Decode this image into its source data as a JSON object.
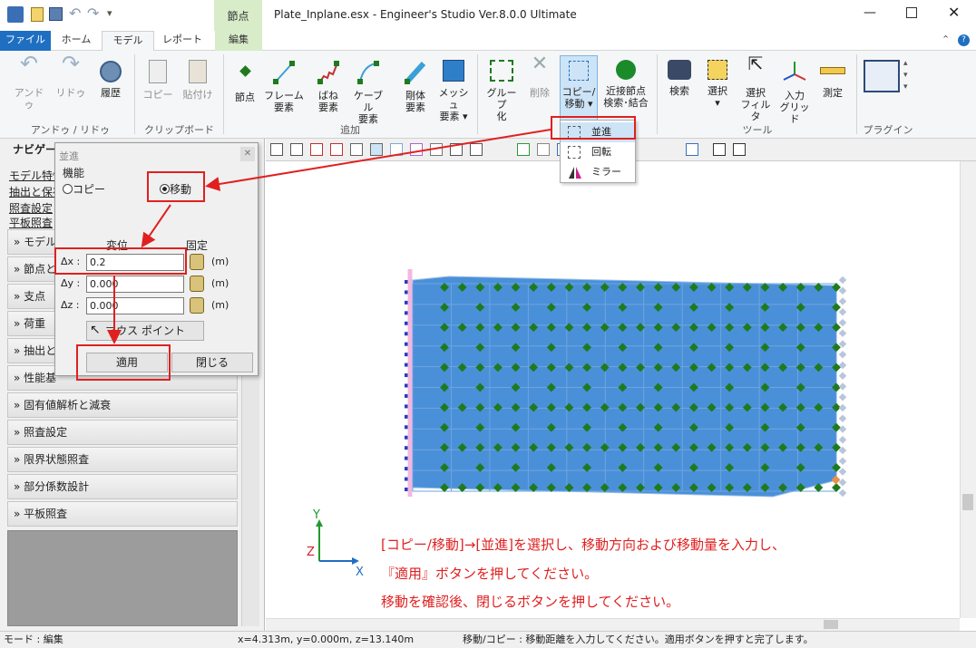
{
  "titlebar": {
    "title": "Plate_Inplane.esx - Engineer's Studio Ver.8.0.0 Ultimate",
    "context_tab": "節点"
  },
  "tabs": [
    "ファイル",
    "ホーム",
    "モデル",
    "レポート",
    "編集"
  ],
  "ribbon": {
    "undo": {
      "items": [
        "アンドゥ",
        "リドゥ",
        "履歴"
      ],
      "group": "アンドゥ / リドゥ"
    },
    "clipboard": {
      "items": [
        "コピー",
        "貼付け"
      ],
      "group": "クリップボード"
    },
    "add": {
      "node": "節点",
      "frame": [
        "フレーム",
        "要素"
      ],
      "spring": [
        "ばね",
        "要素"
      ],
      "cable": [
        "ケーブル",
        "要素"
      ],
      "rigid": [
        "剛体",
        "要素"
      ],
      "mesh": [
        "メッシュ",
        "要素 ▾"
      ],
      "group": "追加"
    },
    "edit": {
      "grouping": [
        "グループ",
        "化"
      ],
      "delete": "削除",
      "copymove": [
        "コピー/",
        "移動 ▾"
      ],
      "nearnode": [
        "近接節点",
        "検索･結合"
      ]
    },
    "tools": {
      "search": "検索",
      "select": [
        "選択",
        "▾"
      ],
      "filter": [
        "選択",
        "フィルタ"
      ],
      "grid": [
        "入力",
        "グリッド"
      ],
      "measure": "測定",
      "group": "ツール"
    },
    "plugin": {
      "group": "プラグイン"
    }
  },
  "dropdown": {
    "items": [
      "並進",
      "回転",
      "ミラー"
    ]
  },
  "navigator": {
    "title": "ナビゲー",
    "links": [
      "モデル特性",
      "抽出と保存",
      "照査設定",
      "平板照査"
    ],
    "rows": [
      "» モデル",
      "» 節点と",
      "» 支点",
      "» 荷重",
      "» 抽出と",
      "» 性能基",
      "» 固有値解析と減衰",
      "» 照査設定",
      "» 限界状態照査",
      "» 部分係数設計",
      "» 平板照査"
    ]
  },
  "dialog": {
    "title": "並進",
    "function_label": "機能",
    "copy": "コピー",
    "move": "移動",
    "disp_header": "変位",
    "fixed_header": "固定",
    "dx_label": "Δx :",
    "dy_label": "Δy :",
    "dz_label": "Δz :",
    "dx": "0.2",
    "dy": "0.000",
    "dz": "0.000",
    "unit": "(m)",
    "mouse_point": "マウス ポイント",
    "apply": "適用",
    "close": "閉じる"
  },
  "axes": {
    "y": "Y",
    "z": "Z",
    "x": "X"
  },
  "instructions": [
    "[コピー/移動]→[並進]を選択し、移動方向および移動量を入力し、",
    "『適用』ボタンを押してください。",
    "移動を確認後、閉じるボタンを押してください。"
  ],
  "status": {
    "mode": "モード : 編集",
    "coords": "x=4.313m, y=0.000m, z=13.140m",
    "message": "移動/コピー : 移動距離を入力してください。適用ボタンを押すと完了します。"
  },
  "colors": {
    "accent": "#1e6fc1",
    "plate": "#4a90d9",
    "node": "#1f7a1f",
    "red": "#e02020"
  }
}
